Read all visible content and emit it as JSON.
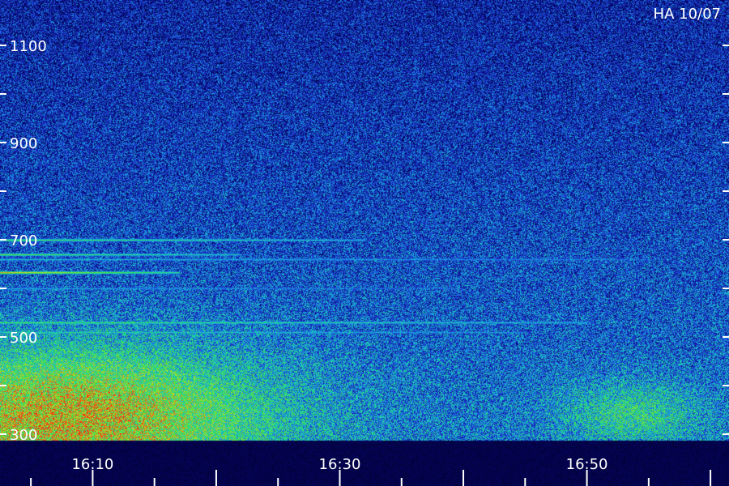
{
  "chart_data": {
    "type": "heatmap",
    "title": "HA 10/07",
    "xlabel": "",
    "ylabel": "",
    "x_tick_labels": [
      "16:10",
      "16:30",
      "16:50"
    ],
    "x_tick_values_min": [
      10,
      30,
      50
    ],
    "x_range_min": [
      2.5,
      61.5
    ],
    "x_minor_step_min": 5,
    "y_tick_labels": [
      "300",
      "500",
      "700",
      "900",
      "1100"
    ],
    "y_tick_values": [
      300,
      500,
      700,
      900,
      1100
    ],
    "y_range": [
      300,
      1110
    ],
    "y_minor_step": 100,
    "colormap": [
      "#000050",
      "#101aa0",
      "#1f40d8",
      "#18a0e0",
      "#20d8a0",
      "#40e040",
      "#c8e020",
      "#ff2a10"
    ],
    "background_level": 0.28,
    "lines": [
      {
        "freq": 700,
        "start_min": 2.5,
        "end_min": 32,
        "level": 0.72
      },
      {
        "freq": 670,
        "start_min": 2.5,
        "end_min": 22,
        "level": 0.74
      },
      {
        "freq": 660,
        "start_min": 2.5,
        "end_min": 55,
        "level": 0.5
      },
      {
        "freq": 633,
        "start_min": 2.5,
        "end_min": 17,
        "level": 0.97
      },
      {
        "freq": 600,
        "start_min": 2.5,
        "end_min": 40,
        "level": 0.45
      },
      {
        "freq": 530,
        "start_min": 2.5,
        "end_min": 50,
        "level": 0.7
      },
      {
        "freq": 510,
        "start_min": 2.5,
        "end_min": 45,
        "level": 0.55
      }
    ],
    "hotspot": {
      "freq": 340,
      "time_min": 8,
      "level": 0.6
    },
    "grid": false,
    "legend": "none"
  }
}
